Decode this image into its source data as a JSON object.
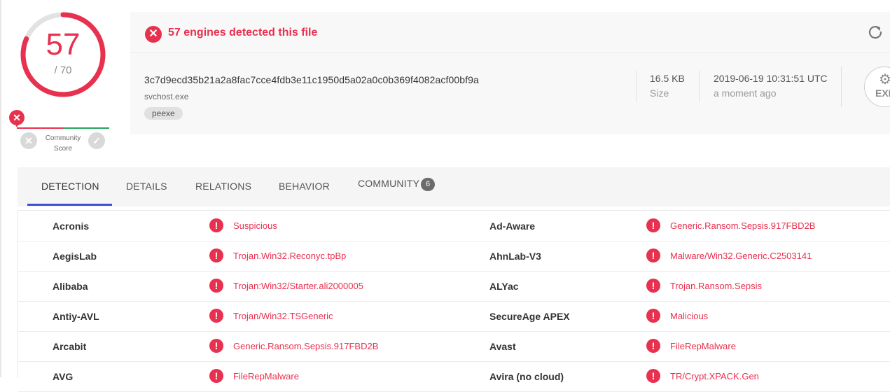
{
  "score": {
    "detected": "57",
    "total": "/ 70",
    "fraction": 0.814
  },
  "community": {
    "label": "Community Score",
    "label_line1": "Community",
    "label_line2": "Score"
  },
  "header": {
    "detection_text": "57 engines detected this file",
    "hash": "3c7d9ecd35b21a2a8fac7cce4fdb3e11c1950d5a02a0c0b369f4082acf00bf9a",
    "filename": "svchost.exe",
    "tag": "peexe",
    "size_value": "16.5 KB",
    "size_label": "Size",
    "date_value": "2019-06-19 10:31:51 UTC",
    "date_label": "a moment ago",
    "filetype_text": "EXE"
  },
  "tabs": [
    {
      "label": "DETECTION",
      "active": true
    },
    {
      "label": "DETAILS"
    },
    {
      "label": "RELATIONS"
    },
    {
      "label": "BEHAVIOR"
    },
    {
      "label": "COMMUNITY",
      "badge": "6"
    }
  ],
  "detections": [
    {
      "left_engine": "Acronis",
      "left_result": "Suspicious",
      "right_engine": "Ad-Aware",
      "right_result": "Generic.Ransom.Sepsis.917FBD2B"
    },
    {
      "left_engine": "AegisLab",
      "left_result": "Trojan.Win32.Reconyc.tpBp",
      "right_engine": "AhnLab-V3",
      "right_result": "Malware/Win32.Generic.C2503141"
    },
    {
      "left_engine": "Alibaba",
      "left_result": "Trojan:Win32/Starter.ali2000005",
      "right_engine": "ALYac",
      "right_result": "Trojan.Ransom.Sepsis"
    },
    {
      "left_engine": "Antiy-AVL",
      "left_result": "Trojan/Win32.TSGeneric",
      "right_engine": "SecureAge APEX",
      "right_result": "Malicious"
    },
    {
      "left_engine": "Arcabit",
      "left_result": "Generic.Ransom.Sepsis.917FBD2B",
      "right_engine": "Avast",
      "right_result": "FileRepMalware"
    },
    {
      "left_engine": "AVG",
      "left_result": "FileRepMalware",
      "right_engine": "Avira (no cloud)",
      "right_result": "TR/Crypt.XPACK.Gen"
    }
  ],
  "colors": {
    "accent_red": "#e8304f",
    "accent_green": "#25a55f",
    "tab_underline": "#3d4fd6"
  },
  "icons": [
    "close-circle-icon",
    "reload-icon",
    "exclamation-icon",
    "file-type-icon",
    "vote-down-icon",
    "vote-up-icon"
  ]
}
